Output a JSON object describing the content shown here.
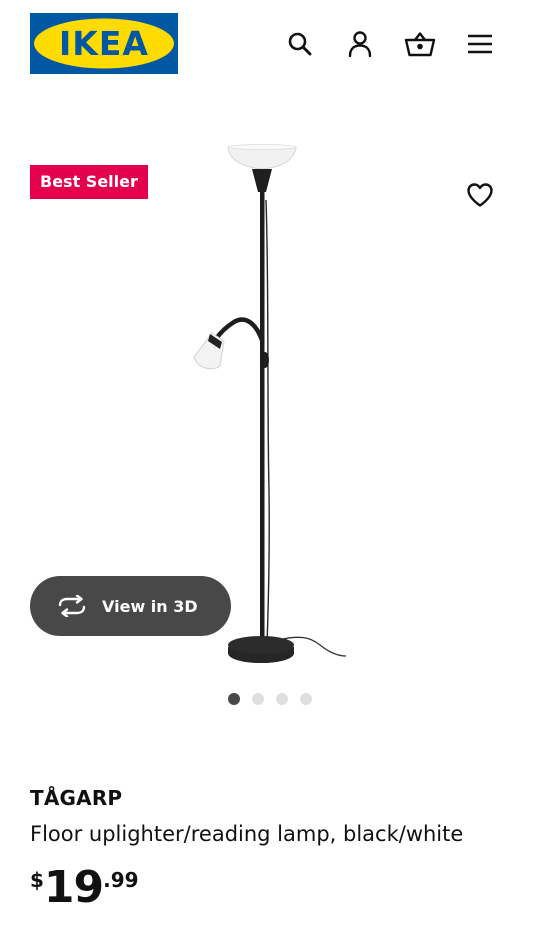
{
  "header": {
    "logo_text": "IKEA",
    "icons": [
      "search-icon",
      "user-icon",
      "basket-icon",
      "menu-icon"
    ]
  },
  "product": {
    "badge": "Best Seller",
    "name": "TÅGARP",
    "description": "Floor uplighter/reading lamp, black/white",
    "price": {
      "currency": "$",
      "integer": "19",
      "decimal": ".99"
    },
    "view_3d_label": "View in 3D",
    "carousel": {
      "count": 4,
      "active_index": 0
    }
  },
  "colors": {
    "brand_blue": "#0058a3",
    "brand_yellow": "#ffdb00",
    "badge_bg": "#e5004e",
    "button_dark": "#484848",
    "text": "#111111"
  }
}
